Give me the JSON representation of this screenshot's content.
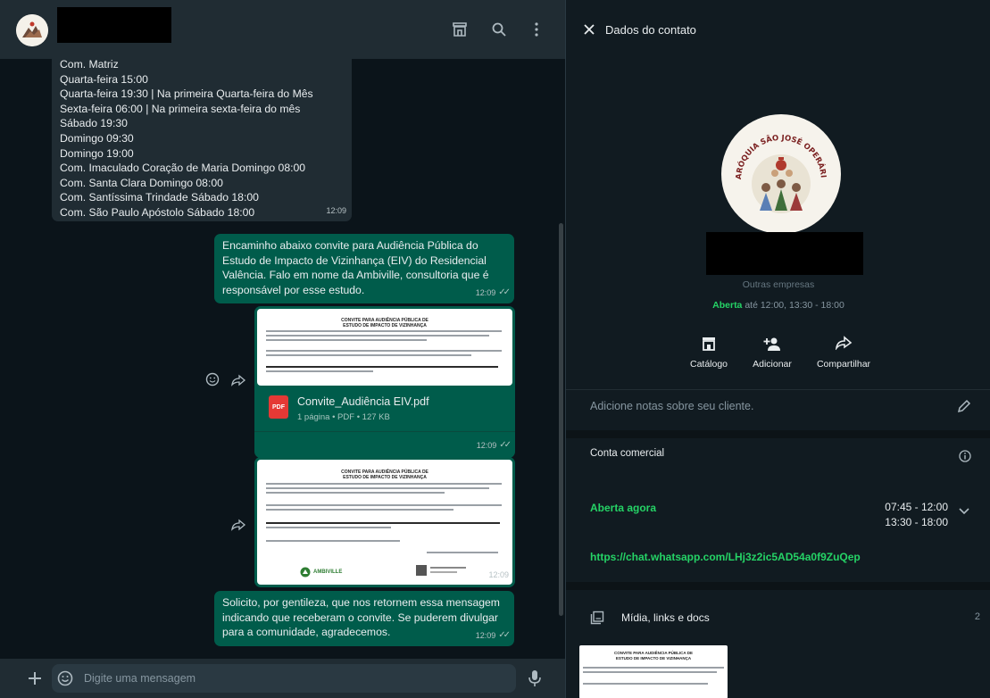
{
  "chat": {
    "input_placeholder": "Digite uma mensagem",
    "messages": {
      "m1": {
        "lines": [
          "Com. Matriz",
          "Quarta-feira 15:00",
          "Quarta-feira 19:30 | Na primeira Quarta-feira do Mês",
          "Sexta-feira 06:00 | Na primeira sexta-feira do mês",
          "Sábado 19:30",
          "Domingo 09:30",
          "Domingo 19:00",
          "Com. Imaculado Coração de Maria Domingo 08:00",
          "Com. Santa Clara Domingo 08:00",
          "Com. Santíssima Trindade Sábado 18:00",
          "Com. São Paulo Apóstolo Sábado 18:00"
        ],
        "time": "12:09"
      },
      "m2": {
        "text": "Encaminho abaixo convite para Audiência Pública do Estudo de Impacto de Vizinhança (EIV) do Residencial Valência. Falo em nome da Ambiville, consultoria que é responsável por esse estudo.",
        "time": "12:09"
      },
      "m3": {
        "thumb_title_1": "CONVITE PARA AUDIÊNCIA PÚBLICA DE",
        "thumb_title_2": "ESTUDO DE IMPACTO DE VIZINHANÇA",
        "file_name": "Convite_Audiência EIV.pdf",
        "file_meta": "1 página • PDF • 127 KB",
        "pdf_label": "PDF",
        "time": "12:09"
      },
      "m4": {
        "thumb_title_1": "CONVITE PARA AUDIÊNCIA PÚBLICA DE",
        "thumb_title_2": "ESTUDO DE IMPACTO DE VIZINHANÇA",
        "logo_text": "AMBIVILLE",
        "time": "12:09"
      },
      "m5": {
        "text": "Solicito, por gentileza, que nos retornem essa mensagem indicando que receberam o convite. Se puderem divulgar para a comunidade, agradecemos.",
        "time": "12:09"
      }
    }
  },
  "contact": {
    "header_title": "Dados do contato",
    "logo_text": "PARÓQUIA SÃO JOSÉ OPERÁRIO",
    "category": "Outras empresas",
    "open_label": "Aberta",
    "open_hours": "até 12:00, 13:30 - 18:00",
    "actions": {
      "catalog": "Catálogo",
      "add": "Adicionar",
      "share": "Compartilhar"
    },
    "notes_placeholder": "Adicione notas sobre seu cliente.",
    "business_account": "Conta comercial",
    "open_now": "Aberta agora",
    "hours_1": "07:45 - 12:00",
    "hours_2": "13:30 - 18:00",
    "link": "https://chat.whatsapp.com/LHj3z2ic5AD54a0f9ZuQep",
    "media_title": "Mídia, links e docs",
    "media_count": "2",
    "media_thumb_title_1": "CONVITE PARA AUDIÊNCIA PÚBLICA DE",
    "media_thumb_title_2": "ESTUDO DE IMPACTO DE VIZINHANÇA"
  },
  "colors": {
    "green": "#25d366",
    "outgoing": "#005c4b",
    "incoming": "#202c33",
    "panel": "#111b21"
  }
}
